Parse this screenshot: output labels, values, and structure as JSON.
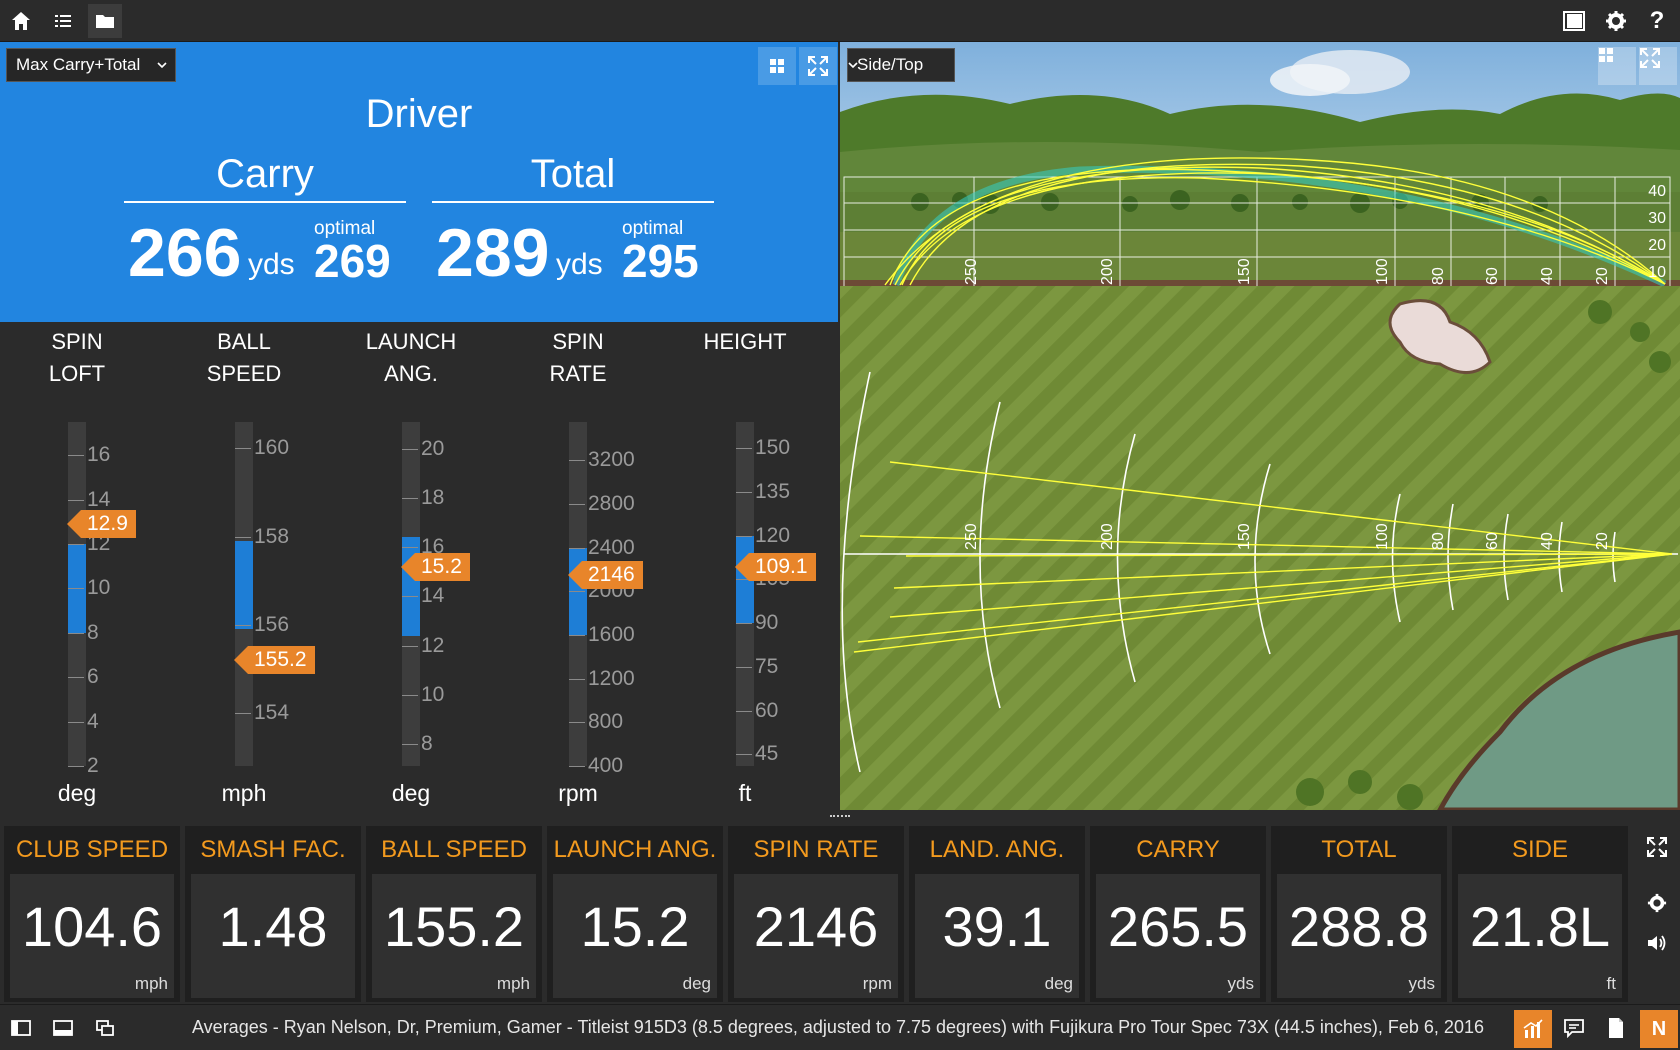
{
  "toolbar": {
    "icons": [
      "home-icon",
      "list-icon",
      "folder-icon",
      "book-icon",
      "gear-icon",
      "help-icon"
    ],
    "help_label": "?"
  },
  "left_panel": {
    "view_select": "Max Carry+Total",
    "club": "Driver",
    "carry": {
      "label": "Carry",
      "value": "266",
      "unit": "yds",
      "optimal_label": "optimal",
      "optimal": "269"
    },
    "total": {
      "label": "Total",
      "value": "289",
      "unit": "yds",
      "optimal_label": "optimal",
      "optimal": "295"
    }
  },
  "gauges": [
    {
      "title_1": "SPIN",
      "title_2": "LOFT",
      "unit": "deg",
      "min": 2,
      "max": 17.5,
      "band": [
        8,
        12
      ],
      "value": 12.9,
      "value_label": "12.9",
      "ticks": [
        "2",
        "4",
        "6",
        "8",
        "10",
        "12",
        "14",
        "16"
      ]
    },
    {
      "title_1": "BALL",
      "title_2": "SPEED",
      "unit": "mph",
      "min": 152.8,
      "max": 160.6,
      "band": [
        155.9,
        157.9
      ],
      "value": 155.2,
      "value_label": "155.2",
      "ticks": [
        "154",
        "156",
        "158",
        "160"
      ]
    },
    {
      "title_1": "LAUNCH",
      "title_2": "ANG.",
      "unit": "deg",
      "min": 7.1,
      "max": 21.1,
      "band": [
        12.4,
        16.4
      ],
      "value": 15.2,
      "value_label": "15.2",
      "ticks": [
        "8",
        "10",
        "12",
        "14",
        "16",
        "18",
        "20"
      ]
    },
    {
      "title_1": "SPIN",
      "title_2": "RATE",
      "unit": "rpm",
      "min": 400,
      "max": 3550,
      "band": [
        1600,
        2400
      ],
      "value": 2146,
      "value_label": "2146",
      "ticks": [
        "400",
        "800",
        "1200",
        "1600",
        "2000",
        "2400",
        "2800",
        "3200"
      ]
    },
    {
      "title_1": "HEIGHT",
      "title_2": "",
      "unit": "ft",
      "min": 41,
      "max": 159,
      "band": [
        90,
        120
      ],
      "value": 109.1,
      "value_label": "109.1",
      "ticks": [
        "45",
        "60",
        "75",
        "90",
        "105",
        "120",
        "135",
        "150"
      ]
    }
  ],
  "right_panel": {
    "view_select": "Side/Top",
    "side_y_labels": [
      "40",
      "30",
      "20",
      "10"
    ],
    "distance_labels": [
      "250",
      "200",
      "150",
      "100",
      "80",
      "60",
      "40",
      "20"
    ]
  },
  "tiles": [
    {
      "title": "CLUB SPEED",
      "value": "104.6",
      "unit": "mph"
    },
    {
      "title": "SMASH FAC.",
      "value": "1.48",
      "unit": ""
    },
    {
      "title": "BALL SPEED",
      "value": "155.2",
      "unit": "mph"
    },
    {
      "title": "LAUNCH ANG.",
      "value": "15.2",
      "unit": "deg"
    },
    {
      "title": "SPIN RATE",
      "value": "2146",
      "unit": "rpm"
    },
    {
      "title": "LAND. ANG.",
      "value": "39.1",
      "unit": "deg"
    },
    {
      "title": "CARRY",
      "value": "265.5",
      "unit": "yds"
    },
    {
      "title": "TOTAL",
      "value": "288.8",
      "unit": "yds"
    },
    {
      "title": "SIDE",
      "value": "21.8L",
      "unit": "ft"
    }
  ],
  "status": {
    "text": "Averages - Ryan Nelson, Dr, Premium, Gamer - Titleist 915D3 (8.5 degrees, adjusted to 7.75 degrees) with Fujikura Pro Tour Spec 73X (44.5 inches), Feb 6, 2016",
    "badge": "N"
  },
  "colors": {
    "accent_blue": "#2285e0",
    "accent_orange": "#e8852a",
    "tile_title": "#f39a1e"
  }
}
